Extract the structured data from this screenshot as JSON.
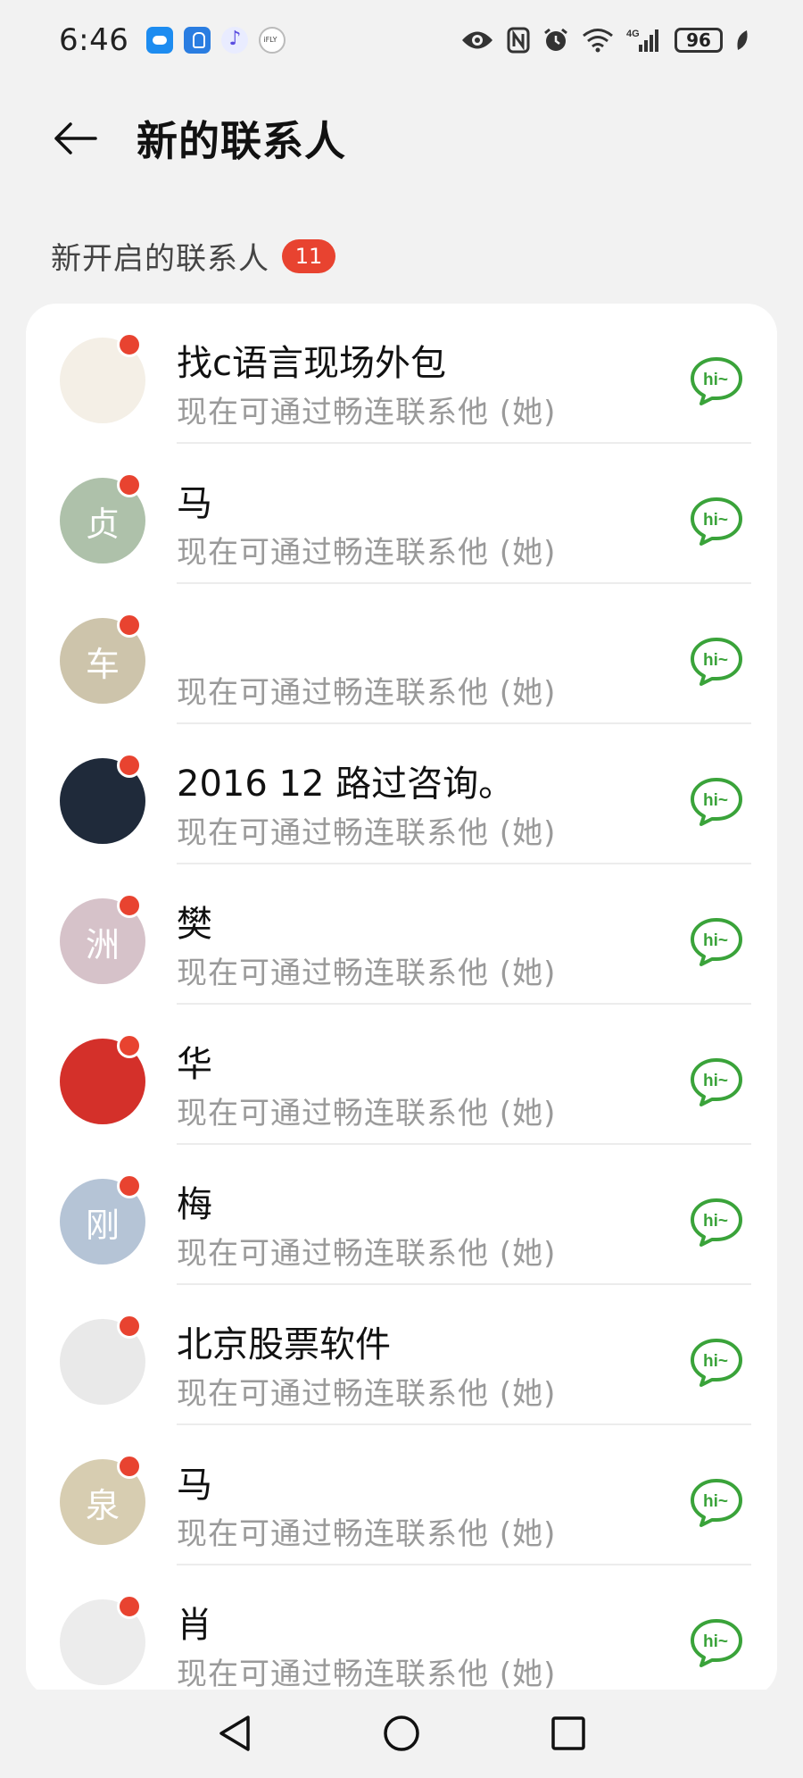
{
  "status": {
    "time": "6:46",
    "battery": "96",
    "network": "4G"
  },
  "header": {
    "title": "新的联系人"
  },
  "section": {
    "label": "新开启的联系人",
    "count": "11"
  },
  "contacts": [
    {
      "name": "找c语言现场外包",
      "subtitle": "现在可通过畅连联系他 (她)",
      "avatar_text": "",
      "avatar_color": "#f4efe6"
    },
    {
      "name": "马",
      "subtitle": "现在可通过畅连联系他 (她)",
      "avatar_text": "贞",
      "avatar_color": "#aec1aa"
    },
    {
      "name": "",
      "subtitle": "现在可通过畅连联系他 (她)",
      "avatar_text": "车",
      "avatar_color": "#cdc4ab"
    },
    {
      "name": "2016 12 路过咨询。",
      "subtitle": "现在可通过畅连联系他 (她)",
      "avatar_text": "",
      "avatar_color": "#1f2a3a"
    },
    {
      "name": "樊",
      "subtitle": "现在可通过畅连联系他 (她)",
      "avatar_text": "洲",
      "avatar_color": "#d6c2c9"
    },
    {
      "name": "华",
      "subtitle": "现在可通过畅连联系他 (她)",
      "avatar_text": "",
      "avatar_color": "#d4302a"
    },
    {
      "name": "梅",
      "subtitle": "现在可通过畅连联系他 (她)",
      "avatar_text": "刚",
      "avatar_color": "#b5c4d6"
    },
    {
      "name": "北京股票软件",
      "subtitle": "现在可通过畅连联系他 (她)",
      "avatar_text": "",
      "avatar_color": "#e9e9e9"
    },
    {
      "name": "马",
      "subtitle": "现在可通过畅连联系他 (她)",
      "avatar_text": "泉",
      "avatar_color": "#d7cdb1"
    },
    {
      "name": "肖",
      "subtitle": "现在可通过畅连联系他 (她)",
      "avatar_text": "",
      "avatar_color": "#ececec"
    }
  ],
  "colors": {
    "accent_green": "#3aa33a",
    "badge_red": "#e84330",
    "background": "#f2f2f2"
  },
  "icons": {
    "back": "arrow-left-icon",
    "greet": "hi-chat-bubble-icon",
    "nav_back": "triangle-back-icon",
    "nav_home": "circle-home-icon",
    "nav_recent": "square-recents-icon"
  }
}
